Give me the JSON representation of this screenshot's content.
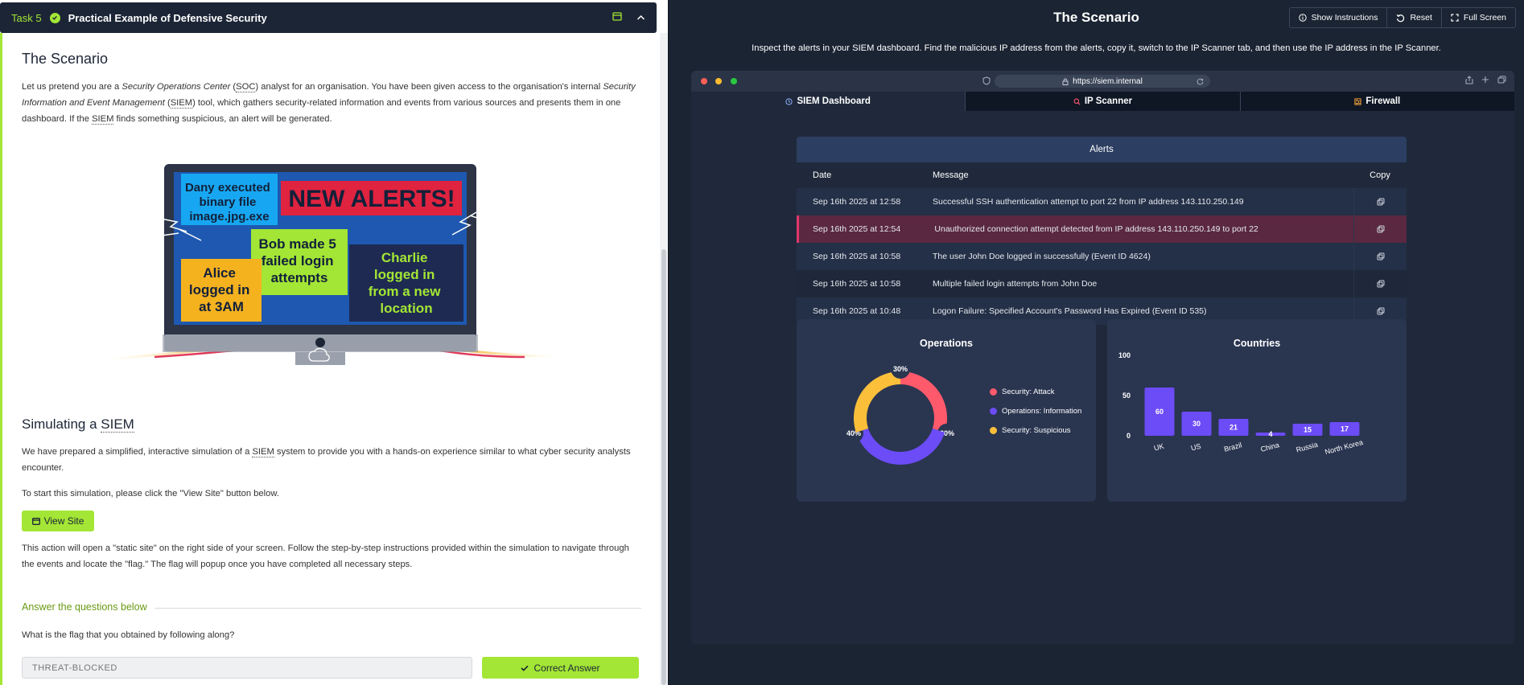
{
  "task": {
    "number": "Task 5",
    "title": "Practical Example of Defensive Security"
  },
  "left": {
    "scenario_heading": "The Scenario",
    "p1_a": "Let us pretend you are a ",
    "p1_soc_long": "Security Operations Center",
    "p1_b": " (",
    "p1_soc": "SOC",
    "p1_c": ") analyst for an organisation. You have been given access to the organisation's internal ",
    "p1_siem_long": "Security Information and Event Management",
    "p1_d": " (",
    "p1_siem": "SIEM",
    "p1_e": ") tool, which gathers security-related information and events from various sources and presents them in one dashboard. If the ",
    "p1_siem2": "SIEM",
    "p1_f": " finds something suspicious, an alert will be generated.",
    "hero": {
      "dany": "Dany executed binary file image.jpg.exe",
      "new_alerts": "NEW ALERTS!",
      "bob": "Bob made 5 failed login attempts",
      "alice": "Alice logged in at 3AM",
      "charlie": "Charlie logged in from a new location"
    },
    "sim_heading_a": "Simulating a ",
    "sim_heading_b": "SIEM",
    "p2_a": "We have prepared a simplified, interactive simulation of a ",
    "p2_siem": "SIEM",
    "p2_b": " system to provide you with a hands-on experience similar to what cyber security analysts encounter.",
    "p3": "To start this simulation, please click the \"View Site\" button below.",
    "view_site": "View Site",
    "p4": "This action will open a \"static site\" on the right side of your screen. Follow the step-by-step instructions provided within the simulation to navigate through the events and locate the \"flag.\" The flag will popup once you have completed all necessary steps.",
    "answer_heading": "Answer the questions below",
    "question": "What is the flag that you obtained by following along?",
    "answer_value": "THREAT-BLOCKED",
    "correct": "Correct Answer"
  },
  "right": {
    "title": "The Scenario",
    "buttons": [
      "Show Instructions",
      "Reset",
      "Full Screen"
    ],
    "instructions": "Inspect the alerts in your SIEM dashboard. Find the malicious IP address from the alerts, copy it, switch to the IP Scanner tab, and then use the IP address in the IP Scanner.",
    "url": "https://siem.internal",
    "tabs": [
      "SIEM Dashboard",
      "IP Scanner",
      "Firewall"
    ],
    "alerts_title": "Alerts",
    "columns": [
      "Date",
      "Message",
      "Copy"
    ],
    "alerts": [
      {
        "date": "Sep 16th 2025 at 12:58",
        "message": "Successful SSH authentication attempt to port 22 from IP address 143.110.250.149"
      },
      {
        "date": "Sep 16th 2025 at 12:54",
        "message": "Unauthorized connection attempt detected from IP address 143.110.250.149 to port 22"
      },
      {
        "date": "Sep 16th 2025 at 10:58",
        "message": "The user John Doe logged in successfully (Event ID 4624)"
      },
      {
        "date": "Sep 16th 2025 at 10:58",
        "message": "Multiple failed login attempts from John Doe"
      },
      {
        "date": "Sep 16th 2025 at 10:48",
        "message": "Logon Failure: Specified Account's Password Has Expired (Event ID 535)"
      }
    ]
  },
  "chart_data": [
    {
      "type": "pie",
      "title": "Operations",
      "categories": [
        "Security: Attack",
        "Operations: Information",
        "Security: Suspicious"
      ],
      "values": [
        30,
        40,
        30
      ],
      "labels": [
        "30%",
        "40%",
        "30%"
      ],
      "colors": [
        "#ff5a6b",
        "#6b4cf6",
        "#fbbf3a"
      ],
      "legend": "right"
    },
    {
      "type": "bar",
      "title": "Countries",
      "categories": [
        "UK",
        "US",
        "Brazil",
        "China",
        "Russia",
        "North Korea"
      ],
      "values": [
        60,
        30,
        21,
        4,
        15,
        17
      ],
      "yticks": [
        "0",
        "50",
        "100"
      ],
      "ylim": [
        0,
        100
      ],
      "color": "#6b4cf6"
    }
  ]
}
